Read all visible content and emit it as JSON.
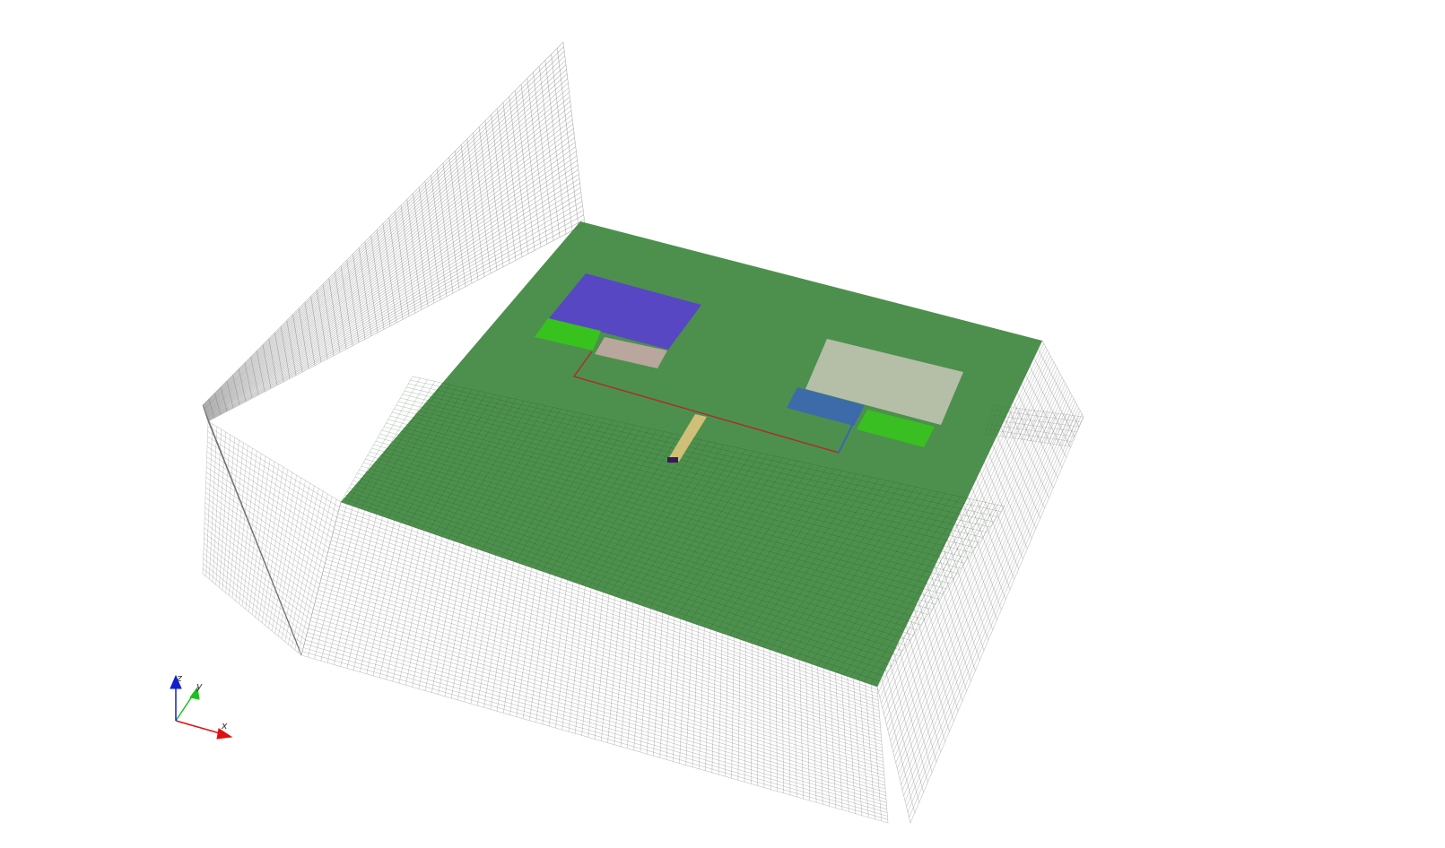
{
  "viewer": {
    "background": "#ffffff",
    "mesh_color": "#777777",
    "substrate_color": "#2e7d2e",
    "colors": {
      "patch_violet": "#5a3fd0",
      "lumped_tan": "#bfa8a0",
      "port_green": "#36c81a",
      "port_blue": "#3c66b4",
      "pad_gray": "#c8c8b8",
      "feed_yellow": "#d6c27a",
      "line_red": "#a83030",
      "source_dark": "#3a1858"
    }
  },
  "axes": {
    "x_label": "x",
    "y_label": "y",
    "z_label": "z",
    "x_color": "#e01010",
    "y_color": "#20c020",
    "z_color": "#1020d0"
  }
}
